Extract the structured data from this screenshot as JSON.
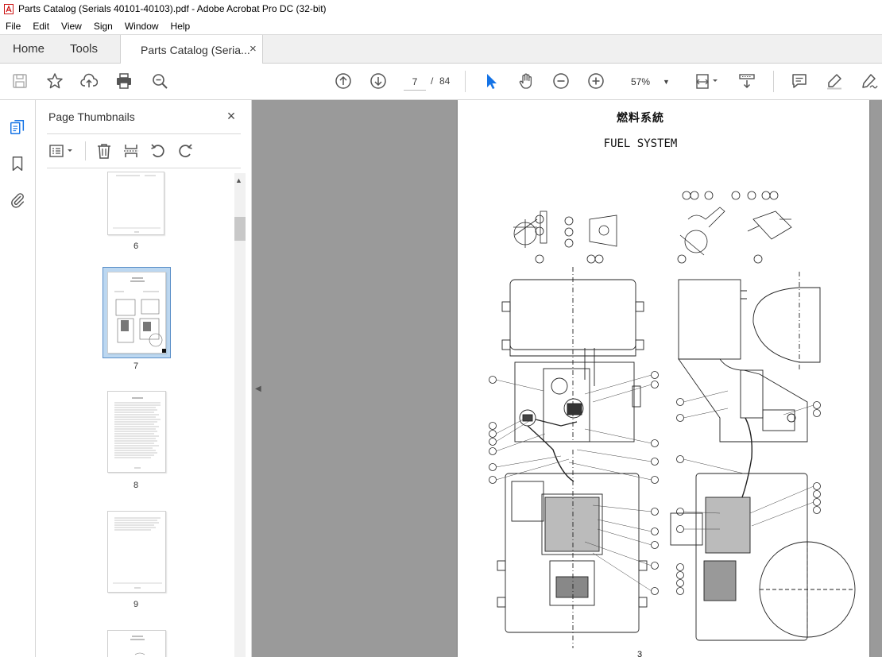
{
  "window": {
    "title": "Parts Catalog (Serials 40101-40103).pdf - Adobe Acrobat Pro DC (32-bit)"
  },
  "menu": [
    "File",
    "Edit",
    "View",
    "Sign",
    "Window",
    "Help"
  ],
  "tabs": {
    "home": "Home",
    "tools": "Tools",
    "document": "Parts Catalog (Seria...",
    "close": "×"
  },
  "toolbar": {
    "current_page": "7",
    "page_separator": "/",
    "total_pages": "84",
    "zoom": "57%",
    "icons": [
      "save-icon",
      "bookmark-star-icon",
      "upload-icon",
      "print-icon",
      "zoom-search-icon",
      "prev-page-icon",
      "next-page-icon",
      "select-cursor-icon",
      "hand-icon",
      "zoom-out-icon",
      "zoom-in-icon",
      "page-fit-icon",
      "scroll-mode-icon",
      "comment-icon",
      "highlight-icon",
      "sign-icon"
    ]
  },
  "left_rail": {
    "icons": [
      "page-thumbnails-icon",
      "bookmarks-icon",
      "attachments-icon"
    ]
  },
  "thumbnail_panel": {
    "title": "Page Thumbnails",
    "close": "×",
    "pages": [
      {
        "label": "6",
        "selected": false
      },
      {
        "label": "7",
        "selected": true
      },
      {
        "label": "8",
        "selected": false
      },
      {
        "label": "9",
        "selected": false
      }
    ]
  },
  "document": {
    "title_jp": "燃料系統",
    "title_en": "FUEL SYSTEM",
    "page_number": "3"
  }
}
